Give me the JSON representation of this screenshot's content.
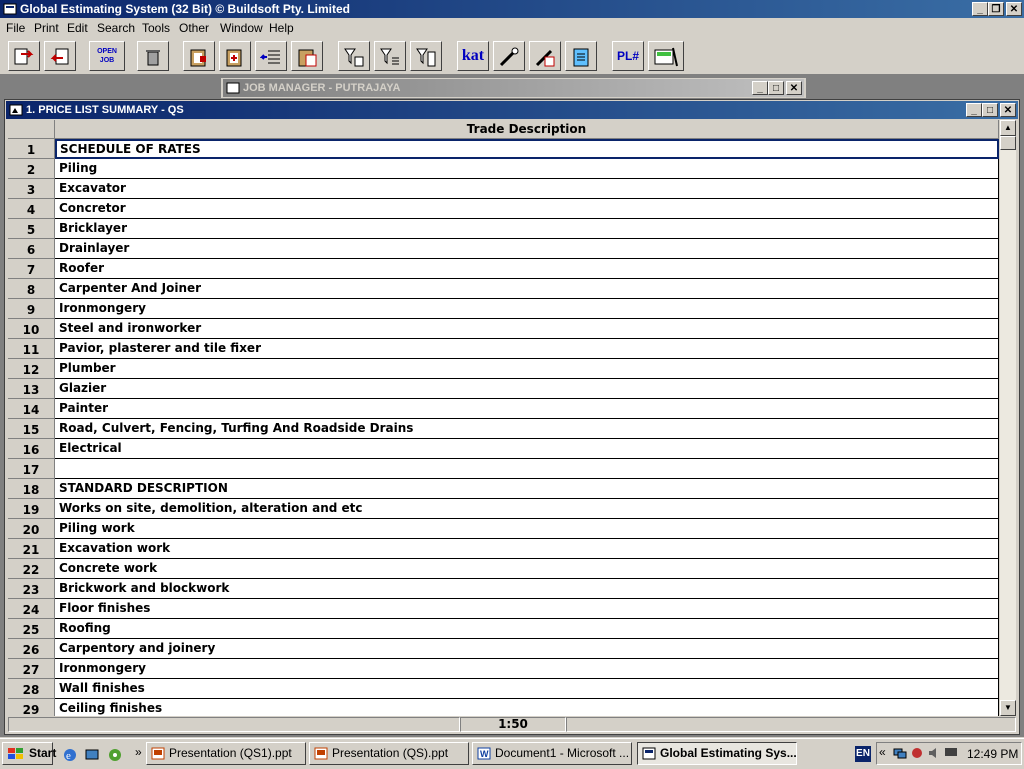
{
  "app": {
    "title": "Global Estimating System (32 Bit) © Buildsoft Pty. Limited"
  },
  "menu": [
    "File",
    "Print",
    "Edit",
    "Search",
    "Tools",
    "Other",
    "Window",
    "Help"
  ],
  "toolbar": {
    "open_job_label": "OPEN\nJOB",
    "kat_label": "kat",
    "pl_label": "PL#"
  },
  "job_manager": {
    "title": "JOB MANAGER - PUTRAJAYA"
  },
  "price_list": {
    "title": "1.  PRICE LIST SUMMARY - QS",
    "column_header": "Trade Description",
    "rows": [
      {
        "num": "1",
        "desc": "SCHEDULE OF RATES"
      },
      {
        "num": "2",
        "desc": "Piling"
      },
      {
        "num": "3",
        "desc": "Excavator"
      },
      {
        "num": "4",
        "desc": "Concretor"
      },
      {
        "num": "5",
        "desc": "Bricklayer"
      },
      {
        "num": "6",
        "desc": "Drainlayer"
      },
      {
        "num": "7",
        "desc": "Roofer"
      },
      {
        "num": "8",
        "desc": "Carpenter And Joiner"
      },
      {
        "num": "9",
        "desc": "Ironmongery"
      },
      {
        "num": "10",
        "desc": "Steel and ironworker"
      },
      {
        "num": "11",
        "desc": "Pavior, plasterer and tile fixer"
      },
      {
        "num": "12",
        "desc": "Plumber"
      },
      {
        "num": "13",
        "desc": "Glazier"
      },
      {
        "num": "14",
        "desc": "Painter"
      },
      {
        "num": "15",
        "desc": "Road, Culvert, Fencing, Turfing And Roadside Drains"
      },
      {
        "num": "16",
        "desc": "Electrical"
      },
      {
        "num": "17",
        "desc": ""
      },
      {
        "num": "18",
        "desc": "STANDARD DESCRIPTION"
      },
      {
        "num": "19",
        "desc": "Works on site, demolition, alteration and etc"
      },
      {
        "num": "20",
        "desc": "Piling work"
      },
      {
        "num": "21",
        "desc": "Excavation work"
      },
      {
        "num": "22",
        "desc": "Concrete work"
      },
      {
        "num": "23",
        "desc": "Brickwork and blockwork"
      },
      {
        "num": "24",
        "desc": "Floor finishes"
      },
      {
        "num": "25",
        "desc": "Roofing"
      },
      {
        "num": "26",
        "desc": "Carpentory and joinery"
      },
      {
        "num": "27",
        "desc": "Ironmongery"
      },
      {
        "num": "28",
        "desc": "Wall finishes"
      },
      {
        "num": "29",
        "desc": "Ceiling finishes"
      }
    ],
    "status_position": "1:50"
  },
  "taskbar": {
    "start_label": "Start",
    "tasks": [
      {
        "label": "Presentation (QS1).ppt"
      },
      {
        "label": "Presentation (QS).ppt"
      },
      {
        "label": "Document1 - Microsoft ..."
      },
      {
        "label": "Global Estimating Sys..."
      }
    ],
    "lang": "EN",
    "clock": "12:49 PM"
  },
  "colors": {
    "active_title": "#0a246a",
    "inactive_title": "#808080",
    "face": "#d4d0c8"
  }
}
